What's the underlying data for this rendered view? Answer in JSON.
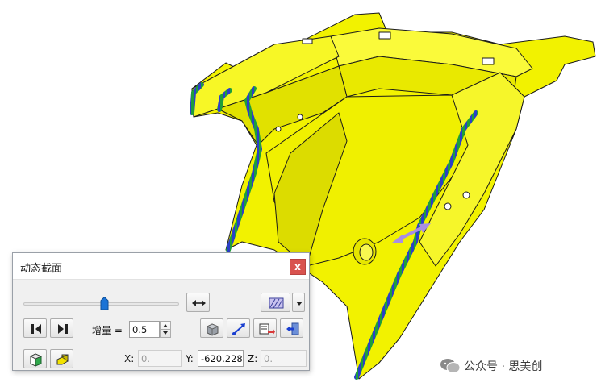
{
  "dialog": {
    "title": "动态截面",
    "close_label": "x",
    "slider": {
      "position_fraction": 0.52
    },
    "increment_label": "增量 =",
    "increment_value": "0.5",
    "x_label": "X:",
    "x_value": "0.",
    "y_label": "Y:",
    "y_value": "-620.228",
    "z_label": "Z:",
    "z_value": "0."
  },
  "watermark": {
    "text": "公众号 · 思美创"
  },
  "colors": {
    "part_fill": "#f2f200",
    "section_edge_green": "#1e9e3a",
    "section_edge_blue": "#2b3fc8",
    "arrow": "#a98ee3",
    "close_red": "#d9534f"
  },
  "icons": [
    "step-back-icon",
    "step-forward-icon",
    "flip-direction-icon",
    "hatch-pattern-icon",
    "dropdown-arrow-icon",
    "shaded-box-icon",
    "align-vector-icon",
    "export-icon",
    "exit-icon",
    "view-cube-icon",
    "section-solid-icon",
    "wechat-logo-icon"
  ]
}
